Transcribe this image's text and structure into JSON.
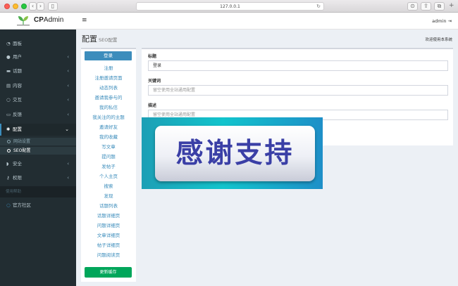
{
  "browser": {
    "url": "127.0.0.1"
  },
  "app": {
    "logo_text_a": "CP",
    "logo_text_b": "Admin",
    "admin_label": "admin"
  },
  "sidebar": {
    "items": [
      {
        "label": "面板",
        "icon": "dashboard-icon"
      },
      {
        "label": "用户",
        "icon": "user-icon"
      },
      {
        "label": "话题",
        "icon": "topic-icon"
      },
      {
        "label": "内容",
        "icon": "content-icon"
      },
      {
        "label": "交互",
        "icon": "interact-icon"
      },
      {
        "label": "反馈",
        "icon": "feedback-icon"
      },
      {
        "label": "配置",
        "icon": "gear-icon"
      },
      {
        "label": "安全",
        "icon": "shield-icon"
      },
      {
        "label": "权限",
        "icon": "key-icon"
      }
    ],
    "subitems": [
      {
        "label": "网站设置"
      },
      {
        "label": "SEO配置"
      }
    ],
    "section_header": "使用帮助",
    "community": "官方社区"
  },
  "page": {
    "title": "配置",
    "subtitle": "SEO配置",
    "welcome": "欢迎使用本系统"
  },
  "page_list": {
    "items": [
      "登录",
      "注册",
      "注册邀请页面",
      "动态列表",
      "邀请我参与的",
      "我的私信",
      "我关注的的主题",
      "邀请好友",
      "我的收藏",
      "写文章",
      "提问题",
      "发帖子",
      "个人主页",
      "搜索",
      "发现",
      "话题列表",
      "话题详细页",
      "问题详细页",
      "文章详细页",
      "帖子详细页",
      "问题阅读页"
    ],
    "update_button": "更新缓存"
  },
  "form": {
    "title_label": "标题",
    "title_value": "登录",
    "keywords_label": "关键词",
    "keywords_placeholder": "留空使用全站通用配置",
    "desc_label": "描述",
    "desc_placeholder": "留空使用全站通用配置"
  },
  "banner": {
    "text": "感谢支持"
  },
  "colors": {
    "accent": "#3c8dbc",
    "sidebar": "#222d32",
    "success": "#00a65a"
  }
}
